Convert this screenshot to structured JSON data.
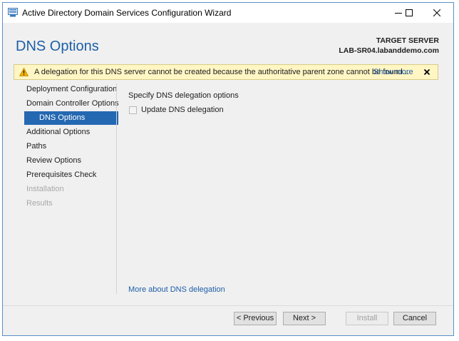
{
  "window": {
    "title": "Active Directory Domain Services Configuration Wizard"
  },
  "header": {
    "page_title": "DNS Options",
    "target_label": "TARGET SERVER",
    "target_value": "LAB-SR04.labanddemo.com"
  },
  "warning": {
    "message": "A delegation for this DNS server cannot be created because the authoritative parent zone cannot be found...",
    "show_more": "Show more",
    "icon": "warning-icon"
  },
  "nav": {
    "items": [
      {
        "label": "Deployment Configuration",
        "state": "normal"
      },
      {
        "label": "Domain Controller Options",
        "state": "normal"
      },
      {
        "label": "DNS Options",
        "state": "selected"
      },
      {
        "label": "Additional Options",
        "state": "normal"
      },
      {
        "label": "Paths",
        "state": "normal"
      },
      {
        "label": "Review Options",
        "state": "normal"
      },
      {
        "label": "Prerequisites Check",
        "state": "normal"
      },
      {
        "label": "Installation",
        "state": "disabled"
      },
      {
        "label": "Results",
        "state": "disabled"
      }
    ]
  },
  "main": {
    "section_label": "Specify DNS delegation options",
    "checkbox_label": "Update DNS delegation",
    "checkbox_checked": false,
    "more_link": "More about DNS delegation"
  },
  "footer": {
    "previous": "< Previous",
    "next": "Next >",
    "install": "Install",
    "cancel": "Cancel"
  },
  "colors": {
    "accent": "#1c5fa6",
    "selection": "#2468b2",
    "warning_bg": "#fff6c4",
    "link": "#1f5ea8"
  }
}
